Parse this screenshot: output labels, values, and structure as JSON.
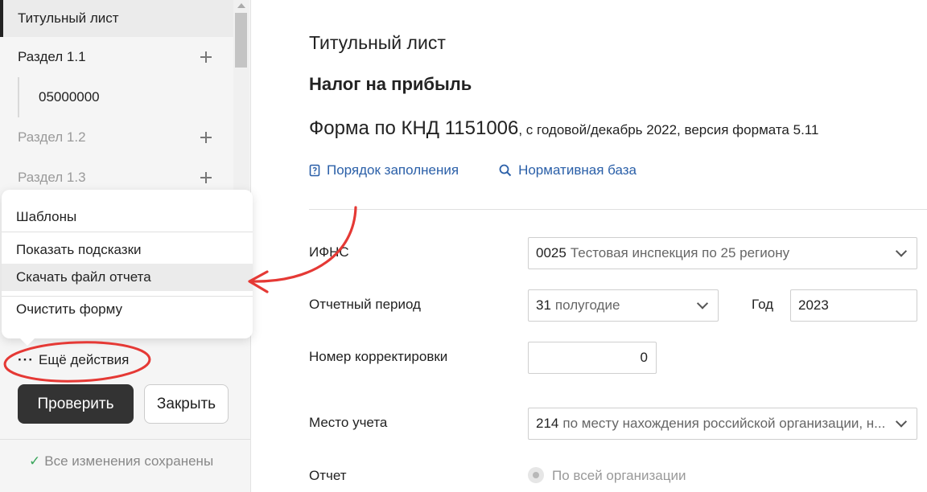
{
  "sidebar": {
    "items": [
      {
        "label": "Титульный лист"
      },
      {
        "label": "Раздел 1.1"
      },
      {
        "label": "05000000"
      },
      {
        "label": "Раздел 1.2"
      },
      {
        "label": "Раздел 1.3"
      }
    ],
    "menu": {
      "templates": "Шаблоны",
      "show_hints": "Показать подсказки",
      "download": "Скачать файл отчета",
      "clear": "Очистить форму"
    },
    "more_actions": "Ещё действия",
    "check_button": "Проверить",
    "close_button": "Закрыть",
    "saved_status": "Все изменения сохранены"
  },
  "main": {
    "page_title": "Титульный лист",
    "form_name": "Налог на прибыль",
    "form_knd": "Форма по КНД 1151006",
    "form_knd_suffix": ", с годовой/декабрь 2022, версия формата 5.11",
    "links": {
      "fill_order": "Порядок заполнения",
      "regulatory": "Нормативная база"
    },
    "fields": {
      "ifns_label": "ИФНС",
      "ifns_code": "0025",
      "ifns_desc": "Тестовая инспекция по 25 региону",
      "period_label": "Отчетный период",
      "period_code": "31",
      "period_desc": "полугодие",
      "year_label": "Год",
      "year_value": "2023",
      "correction_label": "Номер корректировки",
      "correction_value": "0",
      "place_label": "Место учета",
      "place_code": "214",
      "place_desc": "по месту нахождения российской организации, н...",
      "report_label": "Отчет",
      "report_option": "По всей организации"
    }
  },
  "colors": {
    "accent_link": "#2a5fa8",
    "annotation": "#e53935",
    "primary_button": "#333333",
    "saved_check": "#3aa65c"
  }
}
